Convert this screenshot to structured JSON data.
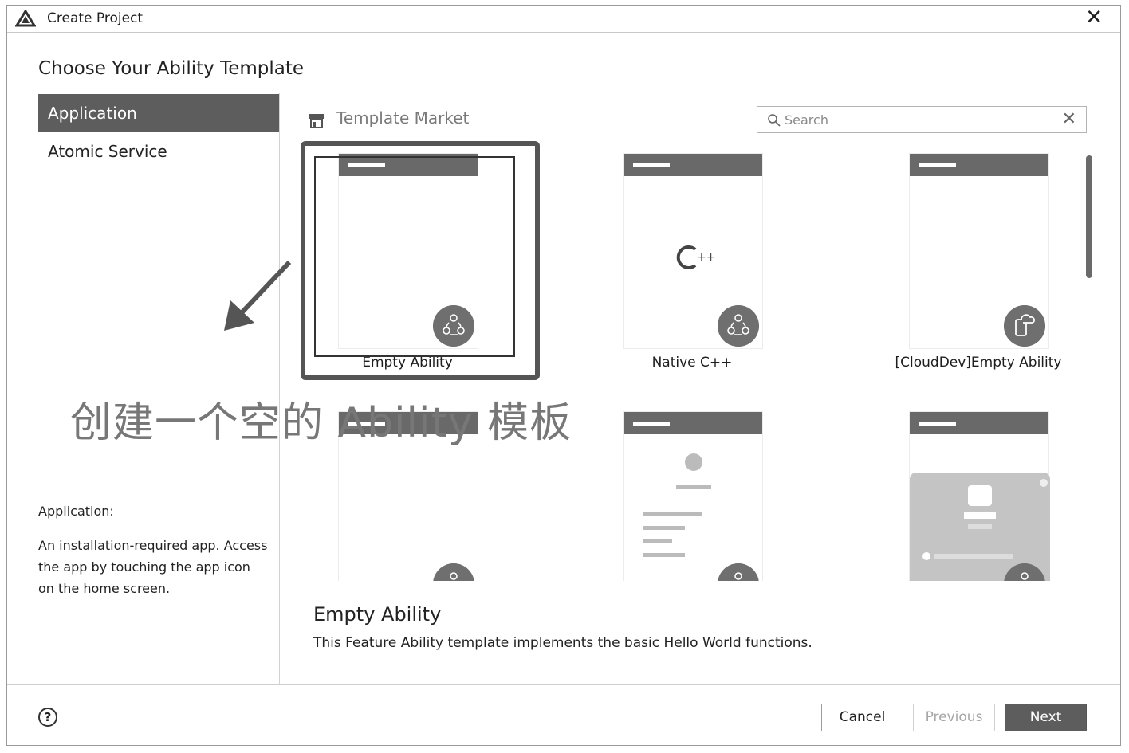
{
  "window": {
    "title": "Create Project",
    "close_glyph": "✕",
    "logo_icon": "triangle-logo-icon"
  },
  "heading": "Choose Your Ability Template",
  "sidebar": {
    "items": [
      {
        "label": "Application",
        "selected": true
      },
      {
        "label": "Atomic Service",
        "selected": false
      }
    ],
    "description": {
      "title": "Application:",
      "body": "An installation-required app. Access the app by touching the app icon on the home screen."
    }
  },
  "market": {
    "label": "Template Market",
    "icon": "store-icon"
  },
  "search": {
    "placeholder": "Search",
    "value": "",
    "clear_glyph": "✕"
  },
  "templates": [
    {
      "label": "Empty Ability",
      "selected": true,
      "badge_icon": "ability-nodes-icon"
    },
    {
      "label": "Native C++",
      "selected": false,
      "badge_icon": "ability-nodes-icon",
      "center_text": "C++"
    },
    {
      "label": "[CloudDev]Empty Ability",
      "selected": false,
      "badge_icon": "cloud-phone-icon"
    },
    {
      "label": "",
      "selected": false,
      "badge_icon": "ability-nodes-icon"
    },
    {
      "label": "",
      "selected": false,
      "badge_icon": "ability-nodes-icon"
    },
    {
      "label": "",
      "selected": false,
      "badge_icon": "ability-nodes-icon"
    }
  ],
  "annotation": "创建一个空的 Ability 模板",
  "detail": {
    "title": "Empty Ability",
    "description": "This Feature Ability template implements the basic Hello World functions."
  },
  "footer": {
    "help_glyph": "?",
    "buttons": {
      "cancel": "Cancel",
      "previous": "Previous",
      "next": "Next"
    }
  },
  "colors": {
    "accent": "#5d5d5d",
    "header_bar": "#696969",
    "annotation": "#777777"
  }
}
